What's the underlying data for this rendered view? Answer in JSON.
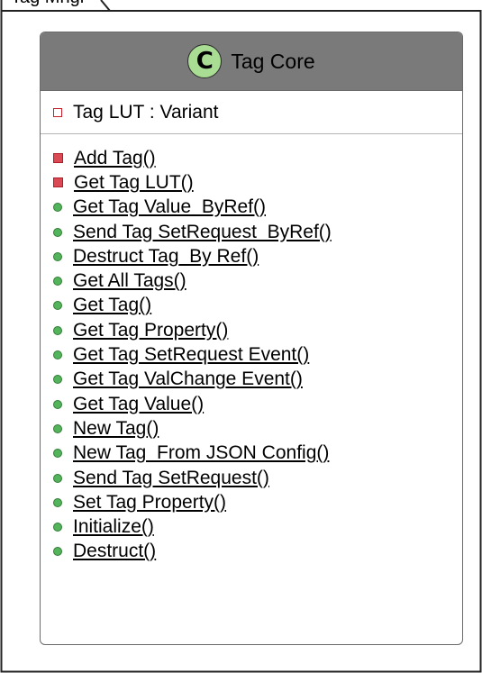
{
  "package": {
    "label": "Tag Mngr"
  },
  "class": {
    "stereotype_letter": "C",
    "name": "Tag Core",
    "attributes": [
      {
        "label": "Tag LUT : Variant",
        "visibility": "private"
      }
    ],
    "operations": [
      {
        "label": "Add Tag()",
        "visibility": "private"
      },
      {
        "label": "Get Tag LUT()",
        "visibility": "private"
      },
      {
        "label": "Get Tag Value_ByRef()",
        "visibility": "public"
      },
      {
        "label": "Send Tag SetRequest_ByRef()",
        "visibility": "public"
      },
      {
        "label": "Destruct Tag_By Ref()",
        "visibility": "public"
      },
      {
        "label": "Get All Tags()",
        "visibility": "public"
      },
      {
        "label": "Get Tag()",
        "visibility": "public"
      },
      {
        "label": "Get Tag Property()",
        "visibility": "public"
      },
      {
        "label": "Get Tag SetRequest Event()",
        "visibility": "public"
      },
      {
        "label": "Get Tag ValChange Event()",
        "visibility": "public"
      },
      {
        "label": "Get Tag Value()",
        "visibility": "public"
      },
      {
        "label": "New Tag()",
        "visibility": "public"
      },
      {
        "label": "New Tag_From JSON Config()",
        "visibility": "public"
      },
      {
        "label": "Send Tag SetRequest()",
        "visibility": "public"
      },
      {
        "label": "Set Tag Property()",
        "visibility": "public"
      },
      {
        "label": "Initialize()",
        "visibility": "public"
      },
      {
        "label": "Destruct()",
        "visibility": "public"
      }
    ]
  },
  "colors": {
    "header_bg": "#7a7a7a",
    "stereotype_circle": "#a9dd93",
    "private_marker": "#d94a55",
    "public_marker": "#53b45b"
  }
}
